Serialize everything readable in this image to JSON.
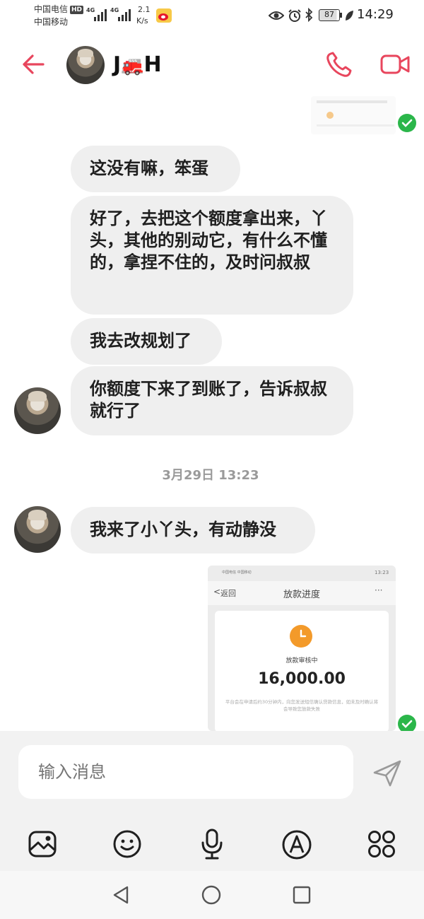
{
  "status_bar": {
    "carrier1": "中国电信",
    "carrier2": "中国移动",
    "hd": "HD",
    "net1": "4G",
    "net2": "4G",
    "speed_value": "2.1",
    "speed_unit": "K/s",
    "battery": "87",
    "time": "14:29"
  },
  "header": {
    "contact_name_left": "J",
    "contact_name_emoji": "🚒",
    "contact_name_right": "H"
  },
  "messages": {
    "m1": "这没有嘛，笨蛋",
    "m2": "好了，去把这个额度拿出来，丫头，其他的别动它，有什么不懂的，拿捏不住的，及时问叔叔",
    "m3": "我去改规划了",
    "m4": "你额度下来了到账了，告诉叔叔就行了",
    "timestamp": "3月29日 13:23",
    "m5": "我来了小丫头，有动静没"
  },
  "shared_screenshot": {
    "back_label": "返回",
    "title": "放款进度",
    "more": "···",
    "status_label": "放款审核中",
    "amount": "16,000.00",
    "notice": "平台会在申请后约30分钟内，向您发送短信确认贷款信息，如未及时确认将会导致您放款失败",
    "mini_status": "中国电信 中国移动",
    "mini_time": "13:23"
  },
  "composer": {
    "placeholder": "输入消息"
  },
  "colors": {
    "accent": "#e8465d",
    "check": "#2bb64a",
    "bubble": "#efefef"
  }
}
